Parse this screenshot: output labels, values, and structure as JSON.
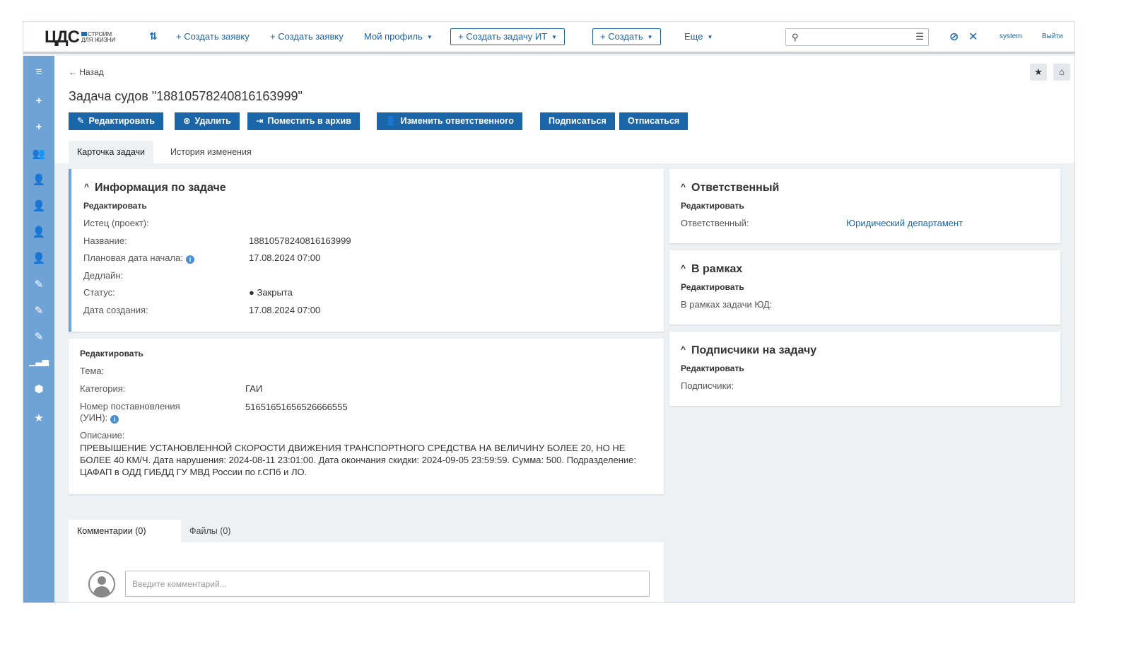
{
  "logo": {
    "main": "ЦДС",
    "sub_line1": "СТРОИМ",
    "sub_line2": "ДЛЯ ЖИЗНИ"
  },
  "topbar": {
    "create_request_1": "+ Создать заявку",
    "create_request_2": "+ Создать заявку",
    "my_profile": "Мой профиль",
    "create_it_task": "+ Создать задачу ИТ",
    "create": "+ Создать",
    "more": "Еще",
    "search_placeholder": "",
    "user": "system",
    "logout": "Выйти"
  },
  "header": {
    "back": "← Назад",
    "title": "Задача судов \"18810578240816163999\"",
    "actions": {
      "edit": "Редактировать",
      "delete": "Удалить",
      "archive": "Поместить в архив",
      "change_responsible": "Изменить ответственного",
      "subscribe": "Подписаться",
      "unsubscribe": "Отписаться"
    },
    "tabs": {
      "card": "Карточка задачи",
      "history": "История изменения"
    }
  },
  "task_info": {
    "title": "Информация по задаче",
    "edit": "Редактировать",
    "plaintiff_label": "Истец (проект):",
    "plaintiff_value": "",
    "name_label": "Название:",
    "name_value": "18810578240816163999",
    "start_label": "Плановая дата начала:",
    "start_value": "17.08.2024 07:00",
    "deadline_label": "Дедлайн:",
    "deadline_value": "",
    "status_label": "Статус:",
    "status_value": "● Закрыта",
    "created_label": "Дата создания:",
    "created_value": "17.08.2024 07:00"
  },
  "details": {
    "edit": "Редактировать",
    "topic_label": "Тема:",
    "topic_value": "",
    "category_label": "Категория:",
    "category_value": "ГАИ",
    "uin_label_1": "Номер поставновления",
    "uin_label_2": "(УИН):",
    "uin_value": "51651651656526666555",
    "description_label": "Описание:",
    "description_text": "ПРЕВЫШЕНИЕ УСТАНОВЛЕННОЙ СКОРОСТИ ДВИЖЕНИЯ ТРАНСПОРТНОГО СРЕДСТВА НА ВЕЛИЧИНУ БОЛЕЕ 20, НО НЕ БОЛЕЕ 40 КМ/Ч. Дата нарушения: 2024-08-11 23:01:00. Дата окончания скидки: 2024-09-05 23:59:59. Сумма: 500. Подразделение: ЦАФАП в ОДД ГИБДД ГУ МВД России по г.СПб и ЛО."
  },
  "responsible": {
    "title": "Ответственный",
    "edit": "Редактировать",
    "label": "Ответственный:",
    "value": "Юридический департамент"
  },
  "scope": {
    "title": "В рамках",
    "edit": "Редактировать",
    "label": "В рамках задачи ЮД:"
  },
  "subscribers": {
    "title": "Подписчики на задачу",
    "edit": "Редактировать",
    "label": "Подписчики:"
  },
  "comments": {
    "tab_comments": "Комментарии (0)",
    "tab_files": "Файлы (0)",
    "placeholder": "Введите комментарий..."
  }
}
